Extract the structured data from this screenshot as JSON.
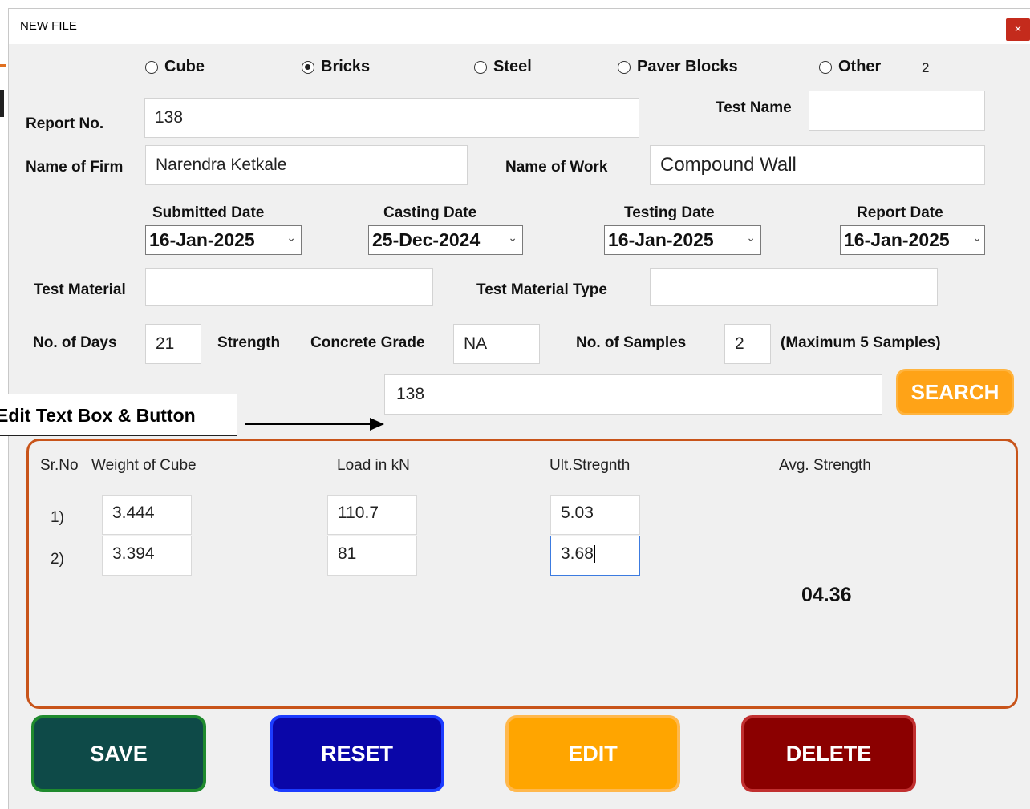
{
  "window": {
    "title": "NEW FILE",
    "close_glyph": "×"
  },
  "test_type": {
    "options": [
      "Cube",
      "Bricks",
      "Steel",
      "Paver Blocks",
      "Other"
    ],
    "selected": "Bricks",
    "count": "2"
  },
  "labels": {
    "report_no": "Report No.",
    "test_name": "Test Name",
    "name_of_firm": "Name of Firm",
    "name_of_work": "Name of Work",
    "submitted_date": "Submitted Date",
    "casting_date": "Casting Date",
    "testing_date": "Testing Date",
    "report_date": "Report Date",
    "test_material": "Test Material",
    "test_material_type": "Test Material Type",
    "no_of_days": "No. of Days",
    "strength": "Strength",
    "concrete_grade": "Concrete Grade",
    "no_of_samples": "No. of Samples",
    "max_samples": "(Maximum 5 Samples)"
  },
  "fields": {
    "report_no": "138",
    "test_name": "",
    "name_of_firm": "Narendra Ketkale",
    "name_of_work": "Compound Wall",
    "submitted_date": "16-Jan-2025",
    "casting_date": "25-Dec-2024",
    "testing_date": "16-Jan-2025",
    "report_date": "16-Jan-2025",
    "test_material": "",
    "test_material_type": "",
    "no_of_days": "21",
    "concrete_grade": "NA",
    "no_of_samples": "2",
    "search_value": "138"
  },
  "search_button": "SEARCH",
  "annotation": {
    "text": "Edit Text Box & Button"
  },
  "results": {
    "headers": {
      "sr_no": "Sr.No",
      "weight": "Weight of Cube",
      "load": "Load in kN",
      "ult": "Ult.Stregnth",
      "avg": "Avg. Strength"
    },
    "rows": [
      {
        "sr": "1)",
        "weight": "3.444",
        "load": "110.7",
        "ult": "5.03"
      },
      {
        "sr": "2)",
        "weight": "3.394",
        "load": "81",
        "ult": "3.68"
      }
    ],
    "avg_strength": "04.36"
  },
  "buttons": {
    "save": "SAVE",
    "reset": "RESET",
    "edit": "EDIT",
    "delete": "DELETE"
  },
  "colors": {
    "save_bg": "#0e4a48",
    "save_border": "#1f8a2e",
    "reset_bg": "#0a06a8",
    "reset_border": "#1c3cff",
    "edit_bg": "#ffa500",
    "edit_border": "#ffb84d",
    "delete_bg": "#8b0000",
    "delete_border": "#c13030",
    "search_bg": "#ffa317",
    "results_border": "#c8541a",
    "focus_border": "#3c7be0"
  }
}
